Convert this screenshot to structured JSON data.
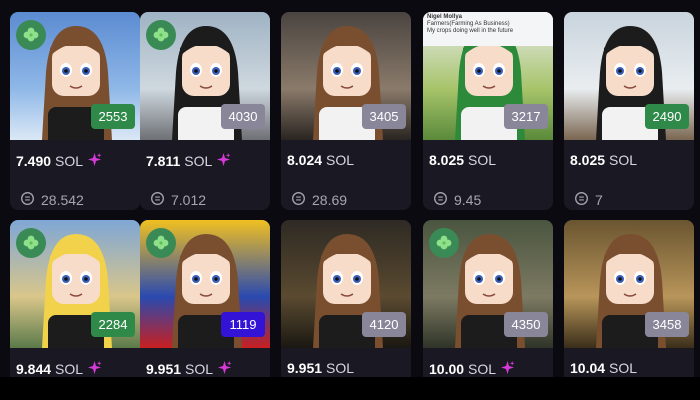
{
  "grid": {
    "cards": [
      {
        "id": "2553",
        "price": "7.490",
        "currency": "SOL",
        "rarity_spark": true,
        "last_sale": "28.542",
        "clover": true,
        "badge_color": "green",
        "bg": "sky"
      },
      {
        "id": "4030",
        "price": "7.811",
        "currency": "SOL",
        "rarity_spark": true,
        "last_sale": "7.012",
        "clover": true,
        "badge_color": "grey",
        "bg": "highway"
      },
      {
        "id": "3405",
        "price": "8.024",
        "currency": "SOL",
        "rarity_spark": false,
        "last_sale": "28.69",
        "clover": false,
        "badge_color": "grey",
        "bg": "car"
      },
      {
        "id": "3217",
        "price": "8.025",
        "currency": "SOL",
        "rarity_spark": false,
        "last_sale": "9.45",
        "clover": false,
        "badge_color": "grey",
        "bg": "field"
      },
      {
        "id": "2490",
        "price": "8.025",
        "currency": "SOL",
        "rarity_spark": false,
        "last_sale": "7",
        "clover": false,
        "badge_color": "green",
        "bg": "yacht"
      },
      {
        "id": "2284",
        "price": "9.844",
        "currency": "SOL",
        "rarity_spark": true,
        "last_sale": "",
        "clover": true,
        "badge_color": "green",
        "bg": "landscape"
      },
      {
        "id": "1119",
        "price": "9.951",
        "currency": "SOL",
        "rarity_spark": true,
        "last_sale": "",
        "clover": true,
        "badge_color": "purple",
        "bg": "flag"
      },
      {
        "id": "4120",
        "price": "9.951",
        "currency": "SOL",
        "rarity_spark": false,
        "last_sale": "",
        "clover": false,
        "badge_color": "grey",
        "bg": "cockpit"
      },
      {
        "id": "4350",
        "price": "10.00",
        "currency": "SOL",
        "rarity_spark": true,
        "last_sale": "",
        "clover": true,
        "badge_color": "grey",
        "bg": "ruins"
      },
      {
        "id": "3458",
        "price": "10.04",
        "currency": "SOL",
        "rarity_spark": false,
        "last_sale": "",
        "clover": false,
        "badge_color": "grey",
        "bg": "hall"
      }
    ]
  },
  "overlay_texts": {
    "tweet_name": "Nigel Mollya",
    "tweet_title": "Farmers(Farming As Business)",
    "tweet_line1": "My crops doing well",
    "tweet_line2": "in the future"
  },
  "colors": {
    "badge_green": "#2f8a4a",
    "badge_grey": "#8a869a",
    "badge_purple": "#3313d6",
    "spark": "#d63ad6",
    "clover_bg": "#3a8a56"
  },
  "icons": {
    "clover": "clover-icon",
    "spark": "sparkle-icon",
    "last_sale": "last-sale-icon"
  }
}
